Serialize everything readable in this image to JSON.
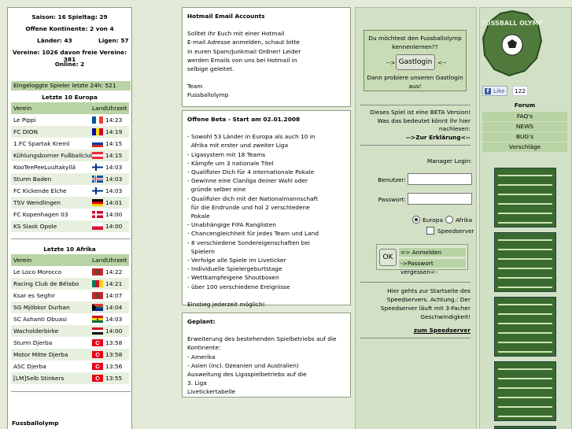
{
  "stats": {
    "saison": "Saison: 16 Spieltag: 29",
    "kontinente": "Offene Kontinente: 2 von 4",
    "laender": "Länder: 43",
    "ligen": "Ligen: 57",
    "vereine": "Vereine: 1026 davon freie Vereine: 381",
    "online": "Online: 2"
  },
  "logged_in_24h": "Eingeloggte Spieler letzte 24h: 521",
  "europe": {
    "title": "Letzte 10 Europa",
    "headers": [
      "Verein",
      "Land",
      "Uhrzeit"
    ],
    "rows": [
      {
        "name": "Le Pippi",
        "flag": "france",
        "time": "14:23"
      },
      {
        "name": "FC DION",
        "flag": "andorra",
        "time": "14:19"
      },
      {
        "name": "1.FC Spartak Kreml",
        "flag": "russia",
        "time": "14:15"
      },
      {
        "name": "Kühlungsborner Fußballclub",
        "flag": "austria",
        "time": "14:15"
      },
      {
        "name": "KooTeePeeLuultakyllä",
        "flag": "finland",
        "time": "14:03"
      },
      {
        "name": "Sturm Baden",
        "flag": "iceland",
        "time": "14:03"
      },
      {
        "name": "FC Kickende Elche",
        "flag": "finland",
        "time": "14:03"
      },
      {
        "name": "TSV Wendlingen",
        "flag": "germany",
        "time": "14:01"
      },
      {
        "name": "FC Kopenhagen 03",
        "flag": "denmark",
        "time": "14:00"
      },
      {
        "name": "KS Slask Opole",
        "flag": "poland",
        "time": "14:00"
      }
    ]
  },
  "africa": {
    "title": "Letzte 10 Afrika",
    "headers": [
      "Verein",
      "Land",
      "Uhrzeit"
    ],
    "rows": [
      {
        "name": "Le Loco Morocco",
        "flag": "morocco",
        "time": "14:22"
      },
      {
        "name": "Racing Club de Bélabo",
        "flag": "cameroon",
        "time": "14:21"
      },
      {
        "name": "Ksar es Seghir",
        "flag": "morocco",
        "time": "14:07"
      },
      {
        "name": "SG Mjöbkor Durban",
        "flag": "southafrica",
        "time": "14:04"
      },
      {
        "name": "SC Ashanti Obuasi",
        "flag": "ghana",
        "time": "14:03"
      },
      {
        "name": "Wacholderbirke",
        "flag": "egypt",
        "time": "14:00"
      },
      {
        "name": "Sturm Djerba",
        "flag": "tunisia",
        "time": "13:58"
      },
      {
        "name": "Motor Mitte Djerba",
        "flag": "tunisia",
        "time": "13:58"
      },
      {
        "name": "ASC Djerba",
        "flag": "tunisia",
        "time": "13:56"
      },
      {
        "name": "[LM]Selb Stinkers",
        "flag": "tunisia",
        "time": "13:55"
      }
    ]
  },
  "footer_left": "Fussballolymp",
  "hotmail": {
    "title": "Hotmail Email Accounts",
    "body": [
      "Solltet Ihr Euch mit einer Hotmail",
      "E-mail Adresse anmelden, schaut bitte",
      "in euren Spam/Junkmail Ordner! Leider",
      "werden Emails von uns bei Hotmail in",
      "selbige geleitet."
    ],
    "sign1": "Team",
    "sign2": "Fussballolymp"
  },
  "beta": {
    "title": "Offene Beta - Start am 02.01.2008",
    "items": [
      "- Sowohl 53 Länder in Europa als auch 10 in",
      "  Afrika mit erster und zweiter Liga",
      "- Ligasystem mit 18 Teams",
      "- Kämpfe um 3 nationale Titel",
      "- Qualifizier Dich für 4 internationale Pokale",
      "- Gewinne eine Clanliga deiner Wahl oder",
      "  gründe selber eine",
      "- Qualifizier dich mit der Nationalmannschaft",
      "  für die Endrunde und hol 2 verschiedene",
      "  Pokale",
      "- Unabhängige FIFA Ranglisten",
      "- Chancengleichheit für jedes Team und Land",
      "- 8 verschiedene Sondereigenschaften bei",
      "  Spielern",
      "- Verfolge alle Spiele im Liveticker",
      "- Individuelle Spielergeburtstage",
      "- Wettkampfeigene Shoutboxen",
      "- über 100 verschiedene Ereignisse"
    ],
    "footer": "Einstieg jederzeit möglich!"
  },
  "geplant": {
    "title": "Geplant:",
    "body": [
      "Erweiterung des bestehenden Spielbetriebs auf die",
      "Kontinente:",
      "- Amerika",
      "- Asien (incl. Ozeanien und Australien)",
      "Ausweitung des Ligaspielbetriebs auf die",
      "3. Liga",
      "Livetickertabelle"
    ]
  },
  "guest": {
    "line1": "Du möchtest den Fussballolymp",
    "line2": "kennenlernen??",
    "arrow_l": "-->",
    "button": "Gastlogin",
    "arrow_r": "<--",
    "line3": "Dann probiere unseren Gastlogin",
    "line4": "aus!"
  },
  "betainfo": {
    "lines": [
      "Dieses Spiel ist eine BETA Version!",
      "Was das bedeutet könnt ihr hier",
      "nachlesen:"
    ],
    "link": "-->Zur Erklärung<--"
  },
  "login": {
    "title": "Manager Login:",
    "user_label": "Benutzer:",
    "pass_label": "Passwort:",
    "opt_europa": "Europa",
    "opt_afrika": "Afrika",
    "speedserver": "Speedserver",
    "ok": "OK",
    "anmelden": "=> Anmelden",
    "vergessen": "->Passwort vergessen<-"
  },
  "speed": {
    "lines": [
      "Hier gehts zur Startseite des",
      "Speedservers. Achtung.: Der",
      "Speedserver läuft mit 3-Facher",
      "Geschwindigkeit!"
    ],
    "link": "zum Speedserver"
  },
  "logo_text": "FUSSBALL OLYMP",
  "like": {
    "label": "Like",
    "count": "122"
  },
  "nav": {
    "forum": "Forum",
    "faq": "FAQ's",
    "news": "NEWS",
    "bugs": "BUG's",
    "vorschlaege": "Vorschläge"
  }
}
